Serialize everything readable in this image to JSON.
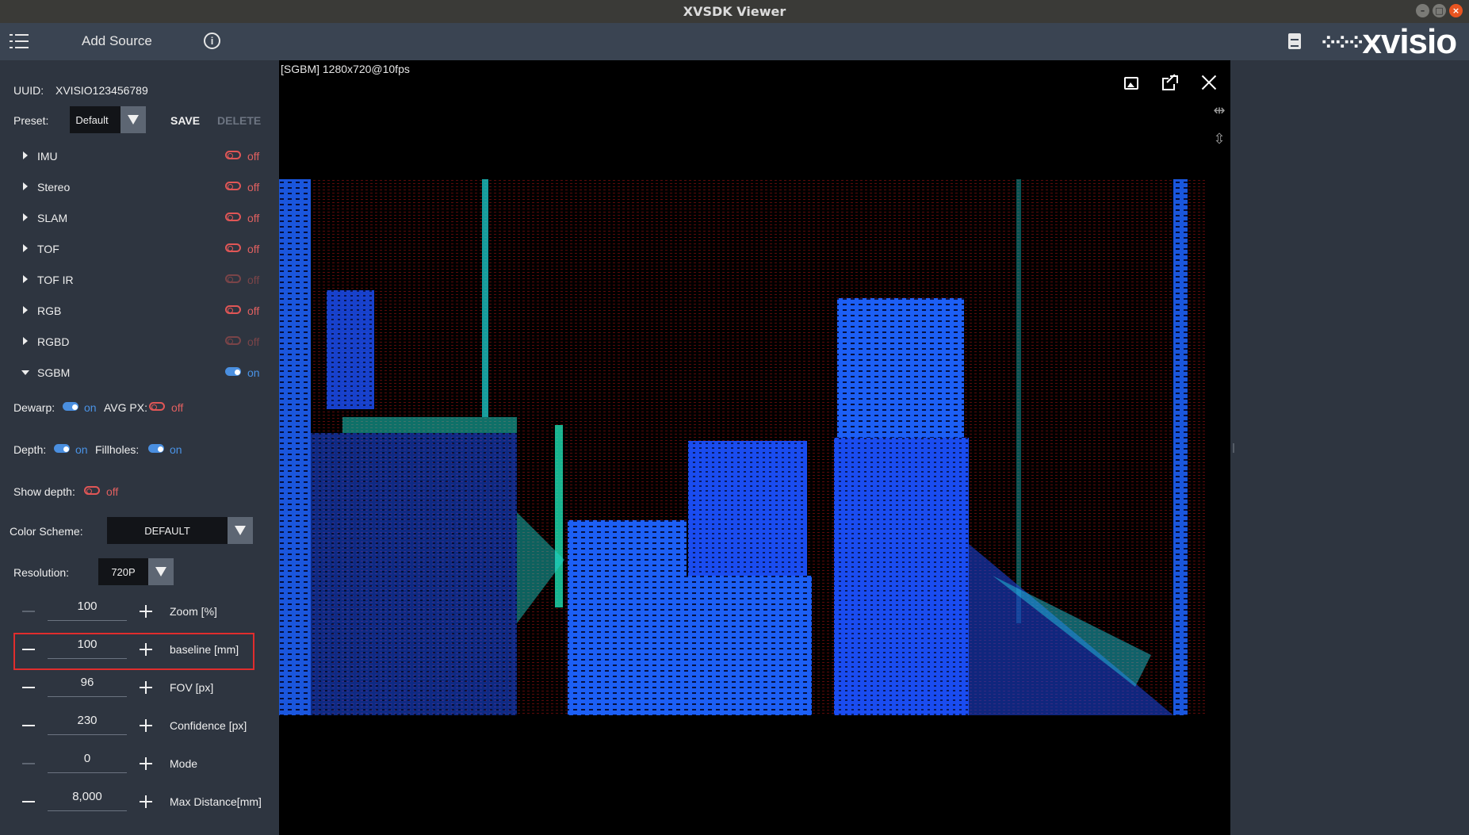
{
  "window": {
    "title": "XVSDK Viewer"
  },
  "appbar": {
    "add_source": "Add Source",
    "info_glyph": "i",
    "logo_text": "xvisio"
  },
  "sidebar": {
    "uuid_label": "UUID:",
    "uuid_value": "XVISIO123456789",
    "preset_label": "Preset:",
    "preset_value": "Default",
    "save_label": "SAVE",
    "delete_label": "DELETE",
    "modules": [
      {
        "name": "IMU",
        "state": "off"
      },
      {
        "name": "Stereo",
        "state": "off"
      },
      {
        "name": "SLAM",
        "state": "off"
      },
      {
        "name": "TOF",
        "state": "off"
      },
      {
        "name": "TOF IR",
        "state": "off"
      },
      {
        "name": "RGB",
        "state": "off"
      },
      {
        "name": "RGBD",
        "state": "off"
      },
      {
        "name": "SGBM",
        "state": "on"
      }
    ],
    "sgbm": {
      "dewarp_label": "Dewarp:",
      "dewarp_state": "on",
      "avgpx_label": "AVG PX:",
      "avgpx_state": "off",
      "depth_label": "Depth:",
      "depth_state": "on",
      "fillholes_label": "Fillholes:",
      "fillholes_state": "on",
      "showdepth_label": "Show depth:",
      "showdepth_state": "off",
      "color_scheme_label": "Color Scheme:",
      "color_scheme_value": "DEFAULT",
      "resolution_label": "Resolution:",
      "resolution_value": "720P"
    },
    "steppers": [
      {
        "label": "Zoom [%]",
        "value": "100"
      },
      {
        "label": "baseline [mm]",
        "value": "100"
      },
      {
        "label": "FOV [px]",
        "value": "96"
      },
      {
        "label": "Confidence [px]",
        "value": "230"
      },
      {
        "label": "Mode",
        "value": "0"
      },
      {
        "label": "Max Distance[mm]",
        "value": "8,000"
      }
    ]
  },
  "viewer": {
    "title": "[SGBM]  1280x720@10fps"
  },
  "colors": {
    "on": "#4a8fe0",
    "off": "#e05656",
    "panel": "#2e3540",
    "highlight": "#e02d2d"
  },
  "icons": [
    "menu-icon",
    "info-icon",
    "document-icon",
    "image-icon",
    "external-link-icon",
    "close-icon",
    "flip-horizontal-icon",
    "flip-vertical-icon"
  ]
}
